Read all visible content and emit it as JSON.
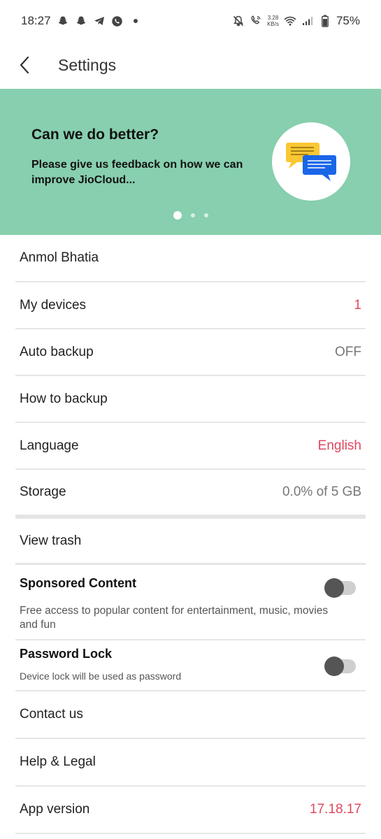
{
  "status_bar": {
    "time": "18:27",
    "speed_value": "3.28",
    "speed_unit": "KB/s",
    "battery": "75%"
  },
  "header": {
    "title": "Settings"
  },
  "banner": {
    "title": "Can we do better?",
    "text": "Please give us feedback on how we can improve JioCloud...",
    "background_color": "#87cfae",
    "page_count": 3,
    "active_page": 1
  },
  "settings": {
    "account_name": "Anmol Bhatia",
    "my_devices": {
      "label": "My devices",
      "value": "1"
    },
    "auto_backup": {
      "label": "Auto backup",
      "value": "OFF"
    },
    "how_to_backup": {
      "label": "How to backup"
    },
    "language": {
      "label": "Language",
      "value": "English"
    },
    "storage": {
      "label": "Storage",
      "value": "0.0% of 5 GB"
    },
    "view_trash": {
      "label": "View trash"
    },
    "sponsored_content": {
      "title": "Sponsored Content",
      "description": "Free access to popular content for entertainment, music, movies and fun",
      "enabled": false
    },
    "password_lock": {
      "title": "Password Lock",
      "description": "Device lock will be used as password",
      "enabled": false
    },
    "contact_us": {
      "label": "Contact us"
    },
    "help_legal": {
      "label": "Help & Legal"
    },
    "app_version": {
      "label": "App version",
      "value": "17.18.17"
    }
  },
  "colors": {
    "accent_red": "#e0475f",
    "muted_value": "#777777",
    "chat_yellow": "#fbc733",
    "chat_blue": "#1a66e8"
  }
}
